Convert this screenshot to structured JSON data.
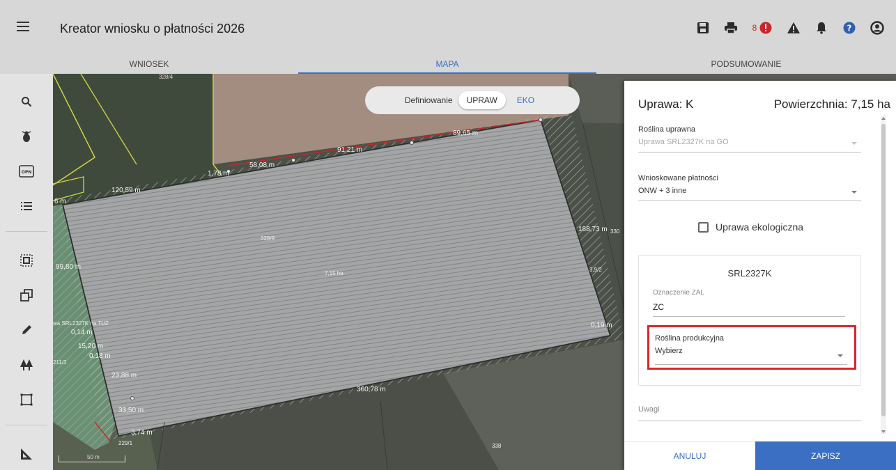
{
  "app": {
    "title": "Kreator wniosku o płatności 2026",
    "notification_count": "8",
    "accent_color": "#3a6fc4",
    "highlight_color": "#d9262c"
  },
  "header_icons": [
    "save-icon",
    "print-icon",
    "error-badge-icon",
    "warning-icon",
    "bell-icon",
    "help-icon",
    "account-icon"
  ],
  "tabs": [
    {
      "label": "WNIOSEK",
      "active": false
    },
    {
      "label": "MAPA",
      "active": true
    },
    {
      "label": "PODSUMOWANIE",
      "active": false
    }
  ],
  "toolbar": [
    "search-icon",
    "pest-icon",
    "opn-icon",
    "list-icon",
    "select-area-icon",
    "copy-shape-icon",
    "edit-pencil-icon",
    "trees-icon",
    "rectangle-select-icon",
    "measure-icon"
  ],
  "toolbar_opn_label": "OPN",
  "map": {
    "mode_label": "Definiowanie",
    "mode_upraw": "UPRAW",
    "mode_eko": "EKO",
    "scale_label": "50 m",
    "parcel_labels": [
      {
        "text": "328/4"
      },
      {
        "text": "328/9"
      },
      {
        "text": "3,9/2"
      },
      {
        "text": "211/3"
      },
      {
        "text": "229/1"
      },
      {
        "text": "338"
      },
      {
        "text": "330"
      },
      {
        "text": "7,15 ha"
      },
      {
        "text": "wa SRL2327K na TUZ"
      }
    ],
    "edge_labels": [
      {
        "text": "89,65 m"
      },
      {
        "text": "91,21 m"
      },
      {
        "text": "58,08 m"
      },
      {
        "text": "1,78 m"
      },
      {
        "text": "120,59 m"
      },
      {
        "text": "6 m"
      },
      {
        "text": "188,73 m"
      },
      {
        "text": "99,80 m"
      },
      {
        "text": "360,78 m"
      },
      {
        "text": "0,14 m"
      },
      {
        "text": "15,20 m"
      },
      {
        "text": "0,18 m"
      },
      {
        "text": "23,88 m"
      },
      {
        "text": "33,50 m"
      },
      {
        "text": "3,74 m"
      },
      {
        "text": "0,19 m"
      }
    ]
  },
  "panel": {
    "title": "Uprawa: K",
    "area": "Powierzchnia: 7,15 ha",
    "crop": {
      "label": "Roślina uprawna",
      "value": "Uprawa SRL2327K na GO"
    },
    "payments": {
      "label": "Wnioskowane płatności",
      "value": "ONW + 3 inne"
    },
    "eco_label": "Uprawa ekologiczna",
    "eco_checked": false,
    "zal": {
      "title": "SRL2327K",
      "designation_label": "Oznaczenie ZAL",
      "designation_value": "ZC",
      "production_label": "Roślina produkcyjna",
      "production_value": "Wybierz"
    },
    "notes_label": "Uwagi",
    "cancel_label": "ANULUJ",
    "save_label": "ZAPISZ"
  }
}
